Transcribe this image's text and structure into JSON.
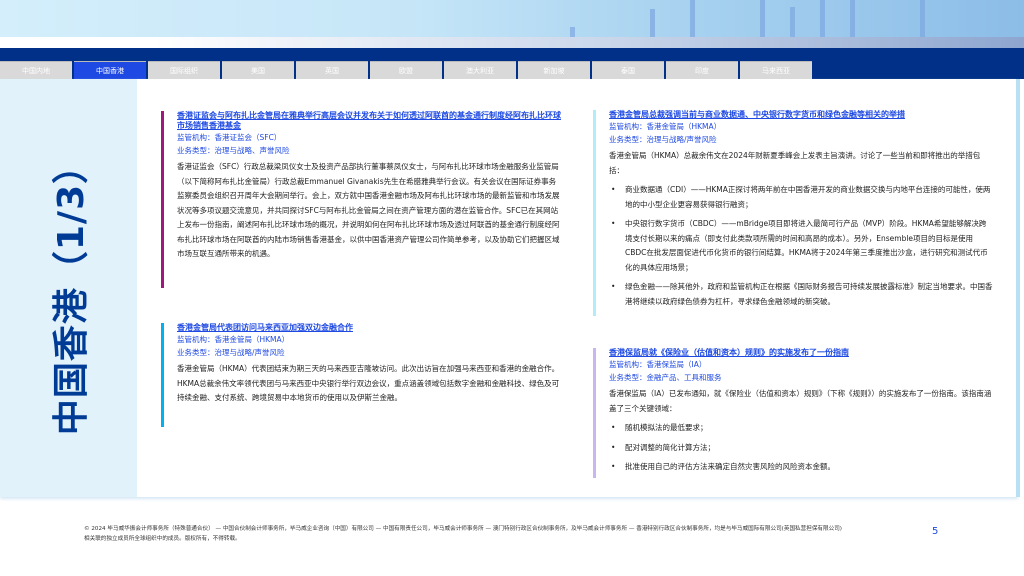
{
  "tabs": [
    "中国内地",
    "中国香港",
    "国际组织",
    "美国",
    "英国",
    "欧盟",
    "澳大利亚",
    "新加坡",
    "泰国",
    "印度",
    "马来西亚"
  ],
  "active_tab": 1,
  "sidebar_title": "中国香港（1/3）",
  "colors": {
    "navy": "#003087",
    "active_tab": "#1e49e2",
    "accent_magenta": "#a3157f",
    "accent_cyan": "#00b0f0",
    "accent_lightcyan": "#b3ecf9",
    "accent_lavender": "#c9b6f0"
  },
  "articles": [
    {
      "title": "香港证监会与阿布扎比金管局在雅典举行高层会议并发布关于如何透过阿联酋的基金通行制度经阿布扎比环球市场销售香港基金",
      "regulator": "监管机构：香港证监会（SFC）",
      "type": "业务类型：治理与战略、声誉风险",
      "body": "香港证监会（SFC）行政总裁梁凤仪女士及投资产品部执行董事蔡凤仪女士，与阿布扎比环球市场金融服务业监管局（以下简称阿布扎比金管局）行政总裁Emmanuel Givanakis先生在希腊雅典举行会议。有关会议在国际证券事务监察委员会组织召开周年大会期间举行。会上，双方就中国香港金融市场及阿布扎比环球市场的最新监管和市场发展状况等多项议题交流意见，并共同探讨SFC与阿布扎比金管局之间在资产管理方面的潜在监管合作。SFC已在其网站上发布一份指南，阐述阿布扎比环球市场的概况，并说明如何在阿布扎比环球市场及透过阿联酋的基金通行制度经阿布扎比环球市场在阿联酋的内陆市场销售香港基金，以供中国香港资产管理公司作简单参考，以及协助它们把握区域市场互联互通所带来的机遇。"
    },
    {
      "title": "香港金管局代表团访问马来西亚加强双边金融合作",
      "regulator": "监管机构：香港金管局（HKMA）",
      "type": "业务类型：治理与战略/声誉风险",
      "body": "香港金管局（HKMA）代表团结束为期三天的马来西亚吉隆坡访问。此次出访旨在加强马来西亚和香港的金融合作。HKMA总裁余伟文率领代表团与马来西亚中央银行举行双边会议，重点涵盖领域包括数字金融和金融科技、绿色及可持续金融、支付系统、跨境贸易中本地货币的使用以及伊斯兰金融。"
    },
    {
      "title": "香港金管局总裁强调当前与商业数据通、中央银行数字货币和绿色金融等相关的举措",
      "regulator": "监管机构：香港金管局（HKMA）",
      "type": "业务类型：治理与战略/声誉风险",
      "body": "香港金管局（HKMA）总裁余伟文在2024年财新夏季峰会上发表主旨演讲。讨论了一些当前和即将推出的举措包括：",
      "bullets": [
        "商业数据通（CDI）——HKMA正探讨将两年前在中国香港开发的商业数据交换与内地平台连接的可能性，使两地的中小型企业更容易获得银行融资；",
        "中央银行数字货币（CBDC）——mBridge项目即将进入最简可行产品（MVP）阶段。HKMA希望能够解决跨境支付长期以来的痛点（即支付此类款项所需的时间和高昂的成本）。另外，Ensemble项目的目标是使用CBDC在批发层面促进代币化货币的银行间结算。HKMA将于2024年第三季度推出沙盒，进行研究和测试代币化的具体应用场景；",
        "绿色金融——除其他外，政府和监管机构正在根据《国际财务报告可持续发展披露标准》制定当地要求。中国香港将继续以政府绿色债券为杠杆，寻求绿色金融领域的新突破。"
      ]
    },
    {
      "title": "香港保监局就《保险业（估值和资本）规则》的实施发布了一份指南",
      "regulator": "监管机构：香港保监局（IA）",
      "type": "业务类型：金融产品、工具和服务",
      "body": "香港保监局（IA）已发布通知，就《保险业（估值和资本）规则》（下称《规则》）的实施发布了一份指南。该指南涵盖了三个关键领域：",
      "bullets": [
        "随机模拟法的最低要求；",
        "配对调整的简化计算方法；",
        "批准使用自己的评估方法来确定自然灾害风险的风险资本金额。"
      ]
    }
  ],
  "footer": "© 2024 毕马威华振会计师事务所（特殊普通合伙） — 中国合伙制会计师事务所，毕马威企业咨询（中国）有限公司 — 中国有限责任公司，毕马威会计师事务所 — 澳门特别行政区合伙制事务所，及毕马威会计师事务所 — 香港特别行政区合伙制事务所，均是与毕马威国际有限公司(英国私营担保有限公司)相关联的独立成员所全球组织中的成员。版权所有，不得转载。",
  "page_number": "5"
}
